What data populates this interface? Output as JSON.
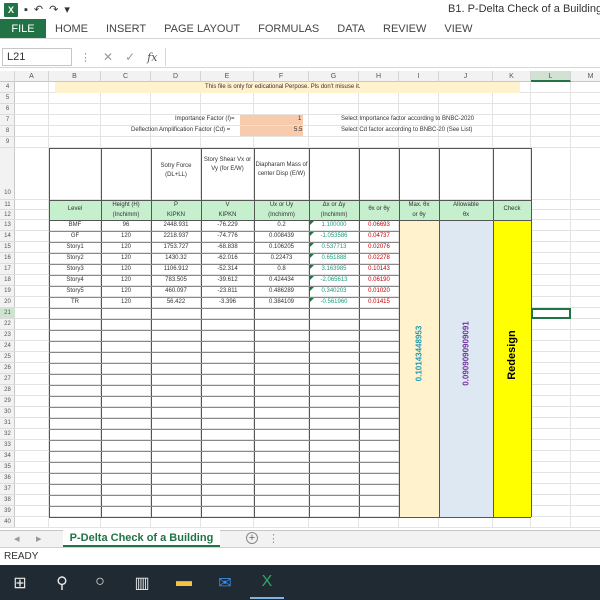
{
  "window": {
    "title": "B1. P-Delta Check of a Building - E"
  },
  "ribbon": {
    "tabs": [
      "FILE",
      "HOME",
      "INSERT",
      "PAGE LAYOUT",
      "FORMULAS",
      "DATA",
      "REVIEW",
      "VIEW"
    ]
  },
  "formula_bar": {
    "name_box": "L21",
    "fx": "fx",
    "content": ""
  },
  "columns": [
    "A",
    "B",
    "C",
    "D",
    "E",
    "F",
    "G",
    "H",
    "I",
    "J",
    "K",
    "L",
    "M"
  ],
  "rows": [
    "4",
    "5",
    "6",
    "7",
    "8",
    "9",
    "10",
    "11",
    "12",
    "13",
    "14",
    "15",
    "16",
    "17",
    "18",
    "19",
    "20",
    "21",
    "22",
    "23",
    "24",
    "25",
    "26",
    "27",
    "28",
    "29",
    "30",
    "31",
    "32",
    "33",
    "34",
    "35",
    "36",
    "37",
    "38",
    "39",
    "40"
  ],
  "sheet": {
    "notice": "This file is only for edicational Perpose. Pls don't misuse it.",
    "importance_label": "Importance Factor (I)=",
    "importance_value": "1",
    "importance_note": "Select Importance factor according to BNBC-2020",
    "cd_label": "Deflection Amplification Factor (Cd) =",
    "cd_value": "5.5",
    "cd_note": "Select Cd factor according to BNBC-20 (See List)",
    "headers": {
      "story_force": "Sotry Force (DL+LL)",
      "story_shear": "Story Shear Vx or Vy (for E/W)",
      "diaphragm": "Diapharam Mass of center Disp (E/W)",
      "level": "Level",
      "height": "Height (H)",
      "height_unit": "(Inchimm)",
      "p": "P",
      "p_unit": "KIPKN",
      "v": "V",
      "v_unit": "KIPKN",
      "ux": "Ux or Uy",
      "ux_unit": "(Inchimm)",
      "dx": "Δx or Δy",
      "dx_unit": "(Inchimm)",
      "theta": "θx or θy",
      "max_theta": "Max. θx",
      "max_theta2": "or θy",
      "allowable": "Allowable",
      "allowable2": "θx",
      "check": "Check"
    },
    "data_rows": [
      {
        "level": "BMF",
        "h": "96",
        "p": "2448.931",
        "v": "-76.229",
        "u": "0.2",
        "d": "1.100000",
        "t": "0.06693"
      },
      {
        "level": "GF",
        "h": "120",
        "p": "2218.937",
        "v": "-74.776",
        "u": "0.008439",
        "d": "-1.053586",
        "t": "0.04737"
      },
      {
        "level": "Story1",
        "h": "120",
        "p": "1753.727",
        "v": "-68.838",
        "u": "0.106205",
        "d": "0.537713",
        "t": "0.02076"
      },
      {
        "level": "Story2",
        "h": "120",
        "p": "1430.32",
        "v": "-62.016",
        "u": "0.22473",
        "d": "0.651888",
        "t": "0.02278"
      },
      {
        "level": "Story3",
        "h": "120",
        "p": "1106.912",
        "v": "-52.314",
        "u": "0.8",
        "d": "3.163985",
        "t": "0.10143"
      },
      {
        "level": "Story4",
        "h": "120",
        "p": "783.505",
        "v": "-39.612",
        "u": "0.424434",
        "d": "-2.065613",
        "t": "0.06190"
      },
      {
        "level": "Story5",
        "h": "120",
        "p": "460.097",
        "v": "-23.811",
        "u": "0.486289",
        "d": "0.340203",
        "t": "0.01020"
      },
      {
        "level": "TR",
        "h": "120",
        "p": "56.422",
        "v": "-3.396",
        "u": "0.384109",
        "d": "-0.561960",
        "t": "0.01415"
      }
    ],
    "max_theta_value": "0.10143448953",
    "allowable_value": "0.0909090909091",
    "check_result": "Redesign"
  },
  "sheet_tab": "P-Delta Check of a Building",
  "status": "READY",
  "colors": {
    "excel_green": "#217346",
    "notice_yellow": "#fff2cc",
    "input_orange": "#f8cbad",
    "check_yellow": "#ffff00",
    "max_col": "#fff2cc",
    "allow_col": "#dde8f2"
  }
}
